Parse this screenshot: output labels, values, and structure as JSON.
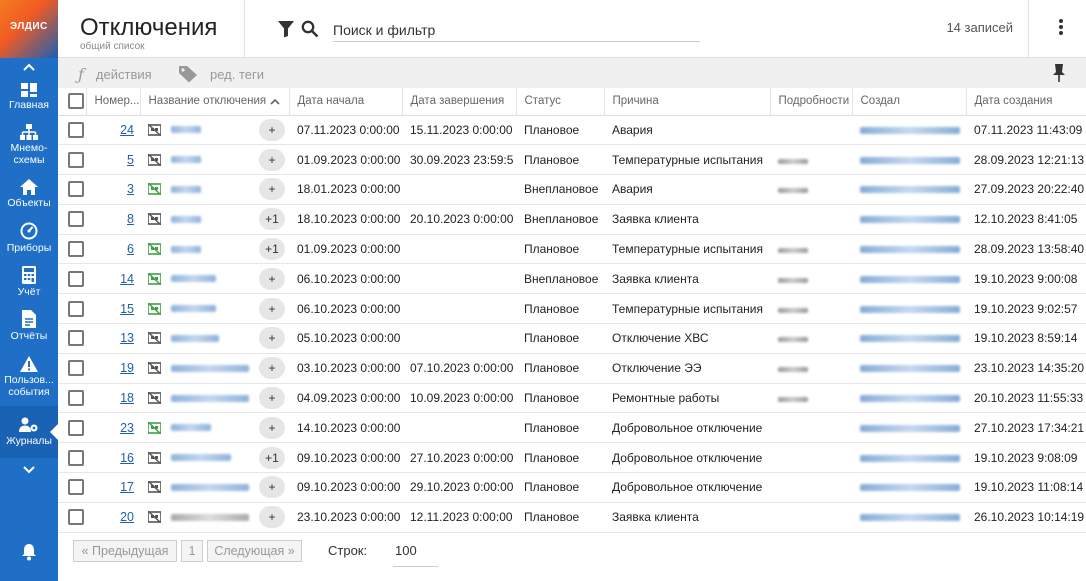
{
  "app": {
    "logo_text": "ЭЛДИС"
  },
  "sidebar": {
    "items": [
      {
        "label": "Главная",
        "icon": "dashboard-icon"
      },
      {
        "label": "Мнемо-схемы",
        "icon": "hierarchy-icon"
      },
      {
        "label": "Объекты",
        "icon": "home-icon"
      },
      {
        "label": "Приборы",
        "icon": "gauge-icon"
      },
      {
        "label": "Учёт",
        "icon": "calculator-icon"
      },
      {
        "label": "Отчёты",
        "icon": "document-icon"
      },
      {
        "label": "Пользов... события",
        "icon": "warning-icon"
      },
      {
        "label": "Журналы",
        "icon": "users-gear-icon",
        "active": true
      }
    ]
  },
  "header": {
    "title": "Отключения",
    "subtitle": "общий список",
    "search_placeholder": "Поиск и фильтр",
    "records": "14 записей"
  },
  "toolbar": {
    "actions_label": "действия",
    "tags_label": "ред. теги"
  },
  "table": {
    "columns": [
      "Номер...",
      "Название отключения",
      "Дата начала",
      "Дата завершения",
      "Статус",
      "Причина",
      "Подробности",
      "Создал",
      "Дата создания"
    ],
    "rows": [
      {
        "num": "24",
        "icon_color": "gray",
        "name_w": 30,
        "name_color": "blue",
        "pill": "+",
        "start": "07.11.2023 0:00:00",
        "end": "15.11.2023 0:00:00",
        "status": "Плановое",
        "reason": "Авария",
        "details": false,
        "created": "07.11.2023 11:43:09"
      },
      {
        "num": "5",
        "icon_color": "gray",
        "name_w": 30,
        "name_color": "blue",
        "pill": "+",
        "start": "01.09.2023 0:00:00",
        "end": "30.09.2023 23:59:5",
        "status": "Плановое",
        "reason": "Температурные испытания",
        "details": true,
        "created": "28.09.2023 12:21:13"
      },
      {
        "num": "3",
        "icon_color": "green",
        "name_w": 30,
        "name_color": "blue",
        "pill": "+",
        "start": "18.01.2023 0:00:00",
        "end": "",
        "status": "Внеплановое",
        "reason": "Авария",
        "details": true,
        "created": "27.09.2023 20:22:40"
      },
      {
        "num": "8",
        "icon_color": "gray",
        "name_w": 30,
        "name_color": "blue",
        "pill": "+1",
        "start": "18.10.2023 0:00:00",
        "end": "20.10.2023 0:00:00",
        "status": "Внеплановое",
        "reason": "Заявка клиента",
        "details": false,
        "created": "12.10.2023 8:41:05"
      },
      {
        "num": "6",
        "icon_color": "green",
        "name_w": 30,
        "name_color": "blue",
        "pill": "+1",
        "start": "01.09.2023 0:00:00",
        "end": "",
        "status": "Плановое",
        "reason": "Температурные испытания",
        "details": true,
        "created": "28.09.2023 13:58:40"
      },
      {
        "num": "14",
        "icon_color": "green",
        "name_w": 45,
        "name_color": "blue",
        "pill": "+",
        "start": "06.10.2023 0:00:00",
        "end": "",
        "status": "Внеплановое",
        "reason": "Заявка клиента",
        "details": true,
        "created": "19.10.2023 9:00:08"
      },
      {
        "num": "15",
        "icon_color": "green",
        "name_w": 45,
        "name_color": "blue",
        "pill": "+",
        "start": "06.10.2023 0:00:00",
        "end": "",
        "status": "Плановое",
        "reason": "Температурные испытания",
        "details": true,
        "created": "19.10.2023 9:02:57"
      },
      {
        "num": "13",
        "icon_color": "gray",
        "name_w": 48,
        "name_color": "blue",
        "pill": "+",
        "start": "05.10.2023 0:00:00",
        "end": "",
        "status": "Плановое",
        "reason": "Отключение ХВС",
        "details": true,
        "created": "19.10.2023 8:59:14"
      },
      {
        "num": "19",
        "icon_color": "gray",
        "name_w": 78,
        "name_color": "blue",
        "pill": "+",
        "start": "03.10.2023 0:00:00",
        "end": "07.10.2023 0:00:00",
        "status": "Плановое",
        "reason": "Отключение ЭЭ",
        "details": true,
        "created": "23.10.2023 14:35:20"
      },
      {
        "num": "18",
        "icon_color": "gray",
        "name_w": 78,
        "name_color": "blue",
        "pill": "+",
        "start": "04.09.2023 0:00:00",
        "end": "10.09.2023 0:00:00",
        "status": "Плановое",
        "reason": "Ремонтные работы",
        "details": true,
        "created": "20.10.2023 11:55:33"
      },
      {
        "num": "23",
        "icon_color": "green",
        "name_w": 40,
        "name_color": "blue",
        "pill": "+",
        "start": "14.10.2023 0:00:00",
        "end": "",
        "status": "Плановое",
        "reason": "Добровольное отключение",
        "details": false,
        "created": "27.10.2023 17:34:21"
      },
      {
        "num": "16",
        "icon_color": "gray",
        "name_w": 60,
        "name_color": "blue",
        "pill": "+1",
        "start": "09.10.2023 0:00:00",
        "end": "27.10.2023 0:00:00",
        "status": "Плановое",
        "reason": "Добровольное отключение",
        "details": false,
        "created": "19.10.2023 9:08:09"
      },
      {
        "num": "17",
        "icon_color": "gray",
        "name_w": 78,
        "name_color": "blue",
        "pill": "+",
        "start": "09.10.2023 0:00:00",
        "end": "29.10.2023 0:00:00",
        "status": "Плановое",
        "reason": "Добровольное отключение",
        "details": false,
        "created": "19.10.2023 11:08:14"
      },
      {
        "num": "20",
        "icon_color": "gray",
        "name_w": 78,
        "name_color": "gray",
        "pill": "+",
        "start": "23.10.2023 0:00:00",
        "end": "12.11.2023 0:00:00",
        "status": "Плановое",
        "reason": "Заявка клиента",
        "details": false,
        "created": "26.10.2023 10:14:19"
      }
    ]
  },
  "footer": {
    "prev": "« Предыдущая",
    "page": "1",
    "next": "Следующая »",
    "rows_label": "Строк:",
    "rows_value": "100"
  },
  "colors": {
    "sidebar": "#1f6fc7",
    "link": "#1f5fa8",
    "icon_green": "#43a047",
    "icon_gray": "#555555"
  }
}
